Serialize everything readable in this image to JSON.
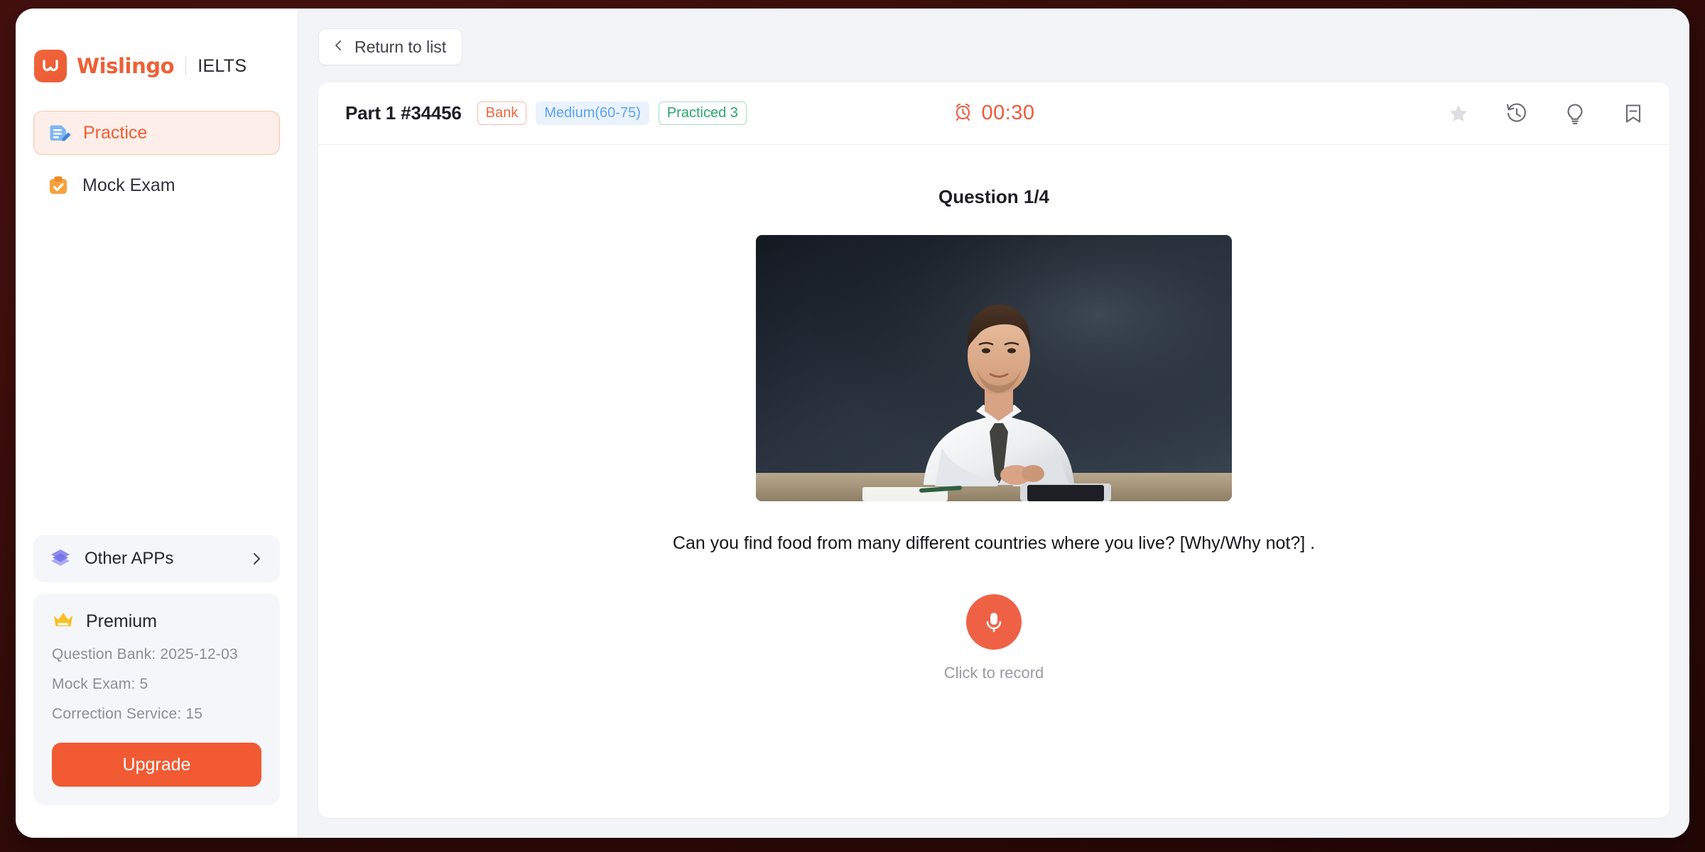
{
  "brand": {
    "name": "Wislingo",
    "product": "IELTS",
    "logo_icon": "wislingo-w-logo"
  },
  "sidebar": {
    "items": [
      {
        "label": "Practice",
        "icon": "document-pencil-icon",
        "active": true
      },
      {
        "label": "Mock Exam",
        "icon": "clipboard-check-icon",
        "active": false
      }
    ],
    "other_apps": {
      "label": "Other APPs",
      "icon": "layers-icon",
      "chevron": "chevron-right-icon"
    },
    "premium": {
      "title": "Premium",
      "icon": "crown-icon",
      "lines": [
        "Question Bank: 2025-12-03",
        "Mock Exam: 5",
        "Correction Service: 15"
      ],
      "upgrade_label": "Upgrade"
    }
  },
  "topbar": {
    "return_label": "Return to list",
    "return_icon": "chevron-left-icon"
  },
  "question_header": {
    "title": "Part 1 #34456",
    "tags": [
      {
        "label": "Bank",
        "style": "bank"
      },
      {
        "label": "Medium(60-75)",
        "style": "level"
      },
      {
        "label": "Practiced 3",
        "style": "practiced"
      }
    ],
    "timer": {
      "icon": "alarm-clock-icon",
      "value": "00:30"
    },
    "actions": [
      {
        "icon": "star-icon",
        "name": "favorite"
      },
      {
        "icon": "history-clock-icon",
        "name": "history"
      },
      {
        "icon": "lightbulb-icon",
        "name": "hint"
      },
      {
        "icon": "bookmark-minus-icon",
        "name": "bookmark"
      }
    ]
  },
  "main": {
    "question_index": "Question 1/4",
    "image_alt": "man-in-white-shirt-and-tie-seated-at-desk-in-front-of-chalkboard",
    "question_text": "Can you find food from many different countries where you live? [Why/Why not?] .",
    "record": {
      "icon": "microphone-icon",
      "hint": "Click to record"
    }
  },
  "colors": {
    "accent": "#f15a33",
    "timer": "#f0583a",
    "tag_bank": "#f0653d",
    "tag_level": "#5aa3f0",
    "tag_practiced": "#28a76a",
    "window_bg": "#f3f4f7",
    "desktop_bg": "#3a0d0b"
  }
}
